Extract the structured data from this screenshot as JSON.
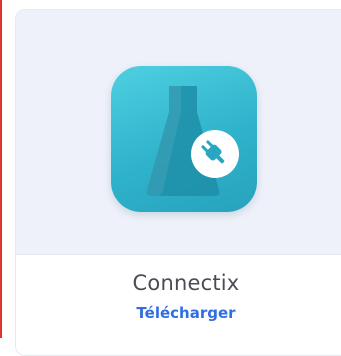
{
  "app_card": {
    "name": "Connectix",
    "action_label": "Télécharger",
    "icon": "connectix-flask-plug-icon",
    "colors": {
      "icon_gradient_start": "#4fd0e1",
      "icon_gradient_end": "#27a2bc",
      "flask_fill": "#1f8ea8",
      "plug_badge": "#ffffff",
      "plug_glyph": "#2aa6c0",
      "link_color": "#2f6fe4",
      "name_color": "#4a4d55",
      "media_background": "#eef1f9"
    }
  }
}
